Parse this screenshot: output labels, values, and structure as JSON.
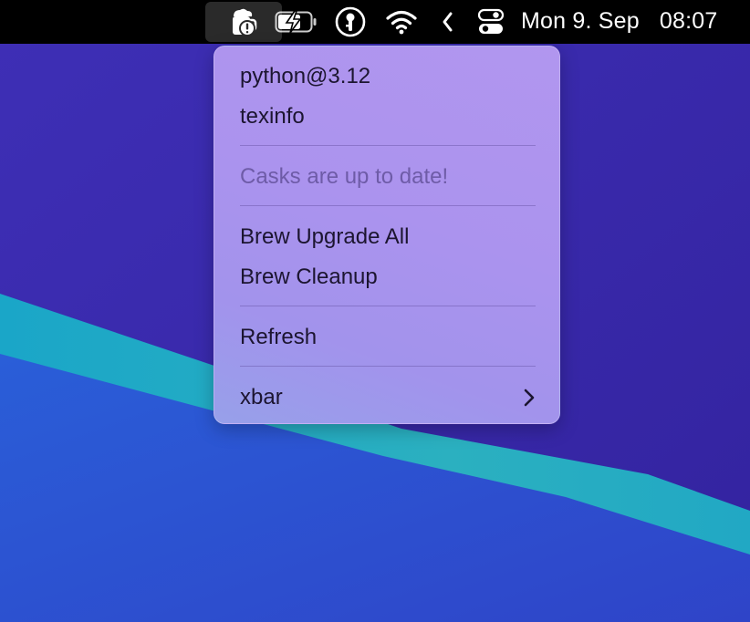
{
  "menubar": {
    "clock": {
      "date": "Mon 9. Sep",
      "time": "08:07"
    },
    "icons": [
      "homebrew-alert-icon",
      "battery-charging-icon",
      "password-manager-icon",
      "wifi-icon",
      "collapse-chevron-icon",
      "control-center-icon"
    ]
  },
  "menu": {
    "outdated": [
      "python@3.12",
      "texinfo"
    ],
    "casks_status": "Casks are up to date!",
    "actions": {
      "upgrade_all": "Brew Upgrade All",
      "cleanup": "Brew Cleanup"
    },
    "refresh": "Refresh",
    "xbar": "xbar"
  }
}
